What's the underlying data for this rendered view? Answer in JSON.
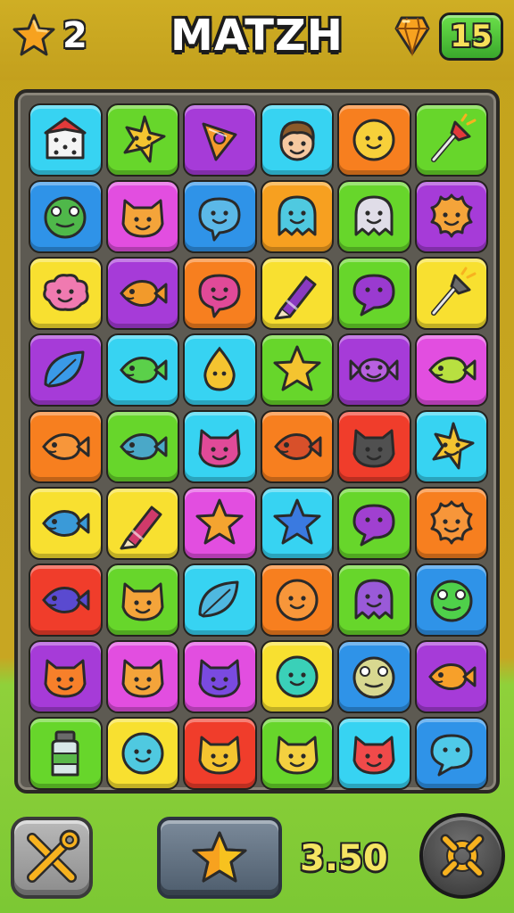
{
  "header": {
    "lives": "2",
    "title": "MATZH",
    "moves": "15",
    "lives_icon": "orange-star-icon",
    "moves_icon": "gem-icon"
  },
  "footer": {
    "score": "3.50",
    "tools_icon": "crossed-tools-icon",
    "boost_icon": "star-icon",
    "settings_icon": "wrench-gear-icon"
  },
  "colors": {
    "cyan": "#37d3f2",
    "green": "#67d62b",
    "purple": "#a63bd8",
    "orange": "#f77f1f",
    "red": "#f03d2b",
    "magenta": "#e24ee0",
    "blue": "#2f93e8",
    "yellow": "#f8e030"
  },
  "board": {
    "rows": [
      [
        {
          "bg": "#37d3f2",
          "icon": "dice-house",
          "fill": "#f4f4f4"
        },
        {
          "bg": "#67d62b",
          "icon": "pointy-star",
          "fill": "#f4c430"
        },
        {
          "bg": "#a63bd8",
          "icon": "candy-cone",
          "fill": "#f29a2b"
        },
        {
          "bg": "#37d3f2",
          "icon": "boy-face",
          "fill": "#f6c9a0"
        },
        {
          "bg": "#f77f1f",
          "icon": "smile-blob",
          "fill": "#f7d03a"
        },
        {
          "bg": "#67d62b",
          "icon": "pin",
          "fill": "#e23a3a"
        }
      ],
      [
        {
          "bg": "#2f93e8",
          "icon": "round-blob",
          "fill": "#4fb84a"
        },
        {
          "bg": "#e24ee0",
          "icon": "cat-blob",
          "fill": "#f4a43a"
        },
        {
          "bg": "#2f93e8",
          "icon": "fish-blob",
          "fill": "#5bb8e8"
        },
        {
          "bg": "#f7a020",
          "icon": "ghost",
          "fill": "#4fc9e0"
        },
        {
          "bg": "#67d62b",
          "icon": "ghost",
          "fill": "#e0dde8"
        },
        {
          "bg": "#a63bd8",
          "icon": "splat",
          "fill": "#f4a43a"
        }
      ],
      [
        {
          "bg": "#f8e030",
          "icon": "cloud-blob",
          "fill": "#f07ab0"
        },
        {
          "bg": "#a63bd8",
          "icon": "fish",
          "fill": "#f29a2b"
        },
        {
          "bg": "#f77f1f",
          "icon": "fish-blob",
          "fill": "#e04a98"
        },
        {
          "bg": "#f8e030",
          "icon": "crayon",
          "fill": "#8a3ac0"
        },
        {
          "bg": "#67d62b",
          "icon": "bubble",
          "fill": "#9a3ad0"
        },
        {
          "bg": "#f8e030",
          "icon": "pin",
          "fill": "#6a6a6a"
        }
      ],
      [
        {
          "bg": "#a63bd8",
          "icon": "leaf",
          "fill": "#3a9ae8"
        },
        {
          "bg": "#37d3f2",
          "icon": "fish",
          "fill": "#5bd04a"
        },
        {
          "bg": "#37d3f2",
          "icon": "teardrop",
          "fill": "#f4c430"
        },
        {
          "bg": "#67d62b",
          "icon": "star",
          "fill": "#f4c430"
        },
        {
          "bg": "#a63bd8",
          "icon": "candy",
          "fill": "#b860e0"
        },
        {
          "bg": "#e24ee0",
          "icon": "fish",
          "fill": "#b8e040"
        }
      ],
      [
        {
          "bg": "#f77f1f",
          "icon": "fish",
          "fill": "#f7963a"
        },
        {
          "bg": "#67d62b",
          "icon": "fish",
          "fill": "#4aa8c8"
        },
        {
          "bg": "#37d3f2",
          "icon": "cat-blob",
          "fill": "#e04a98"
        },
        {
          "bg": "#f77f1f",
          "icon": "fish",
          "fill": "#d8502a"
        },
        {
          "bg": "#f03d2b",
          "icon": "cat-blob",
          "fill": "#505050"
        },
        {
          "bg": "#37d3f2",
          "icon": "pointy-star",
          "fill": "#f4c430"
        }
      ],
      [
        {
          "bg": "#f8e030",
          "icon": "fish",
          "fill": "#3a9ad8"
        },
        {
          "bg": "#f8e030",
          "icon": "crayon",
          "fill": "#d03a6a"
        },
        {
          "bg": "#e24ee0",
          "icon": "star",
          "fill": "#f4a430"
        },
        {
          "bg": "#37d3f2",
          "icon": "star",
          "fill": "#3a7ae0"
        },
        {
          "bg": "#67d62b",
          "icon": "bubble",
          "fill": "#a040d0"
        },
        {
          "bg": "#f77f1f",
          "icon": "splat",
          "fill": "#f7963a"
        }
      ],
      [
        {
          "bg": "#f03d2b",
          "icon": "fish",
          "fill": "#5a4ad0"
        },
        {
          "bg": "#67d62b",
          "icon": "cat-blob",
          "fill": "#f4a43a"
        },
        {
          "bg": "#37d3f2",
          "icon": "leaf",
          "fill": "#4fb8e0"
        },
        {
          "bg": "#f77f1f",
          "icon": "smile-blob",
          "fill": "#f7963a"
        },
        {
          "bg": "#67d62b",
          "icon": "ghost",
          "fill": "#9a5ad8"
        },
        {
          "bg": "#2f93e8",
          "icon": "round-blob",
          "fill": "#4fd04a"
        }
      ],
      [
        {
          "bg": "#a63bd8",
          "icon": "cat-blob",
          "fill": "#f7802a"
        },
        {
          "bg": "#e24ee0",
          "icon": "cat-blob",
          "fill": "#f4a43a"
        },
        {
          "bg": "#e24ee0",
          "icon": "cat-blob",
          "fill": "#7a4ae0"
        },
        {
          "bg": "#f8e030",
          "icon": "smile-blob",
          "fill": "#3ad0b8"
        },
        {
          "bg": "#2f93e8",
          "icon": "round-blob",
          "fill": "#d8d890"
        },
        {
          "bg": "#a63bd8",
          "icon": "fish",
          "fill": "#f7a02a"
        }
      ],
      [
        {
          "bg": "#67d62b",
          "icon": "bottle",
          "fill": "#d8e8e8"
        },
        {
          "bg": "#f8e030",
          "icon": "smile-blob",
          "fill": "#4fc9e0"
        },
        {
          "bg": "#f03d2b",
          "icon": "cat-blob",
          "fill": "#f4c430"
        },
        {
          "bg": "#67d62b",
          "icon": "cat-blob",
          "fill": "#f4d040"
        },
        {
          "bg": "#37d3f2",
          "icon": "cat-blob",
          "fill": "#f04a4a"
        },
        {
          "bg": "#2f93e8",
          "icon": "bubble",
          "fill": "#4fc9e8"
        }
      ]
    ]
  }
}
